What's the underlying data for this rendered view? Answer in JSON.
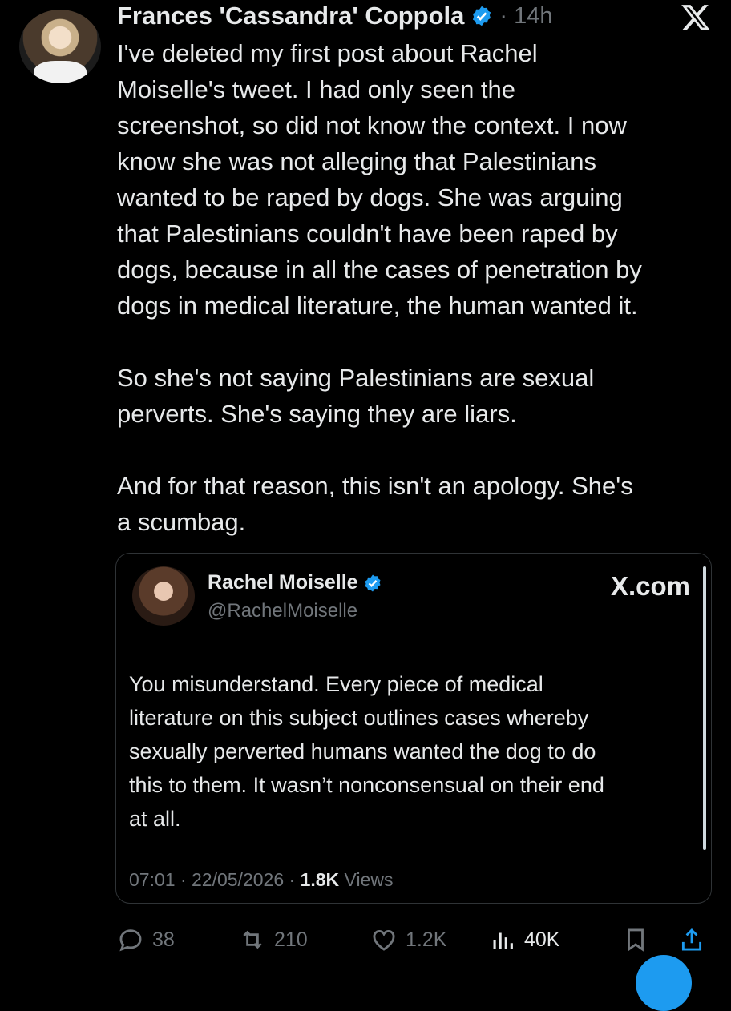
{
  "post": {
    "author": "Frances 'Cassandra' Coppola",
    "separator": "·",
    "time": "14h",
    "text": "I've deleted my first post about Rachel\nMoiselle's tweet. I had only seen the\nscreenshot, so did not know the context. I now\nknow she was not alleging that Palestinians\nwanted to be raped by dogs. She was arguing\nthat Palestinians couldn't have been raped by\ndogs, because in all the cases of penetration by\ndogs in medical literature, the human wanted it.\n\nSo she's not saying Palestinians are sexual\nperverts. She's saying they are liars.\n\nAnd for that reason, this isn't an apology. She's\na scumbag."
  },
  "quote": {
    "name": "Rachel Moiselle",
    "handle": "@RachelMoiselle",
    "site": "X.com",
    "text": "You misunderstand. Every piece of medical\nliterature on this subject outlines cases whereby\nsexually perverted humans wanted the dog to do\nthis to them. It wasn’t nonconsensual on their end\nat all.",
    "time": "07:01 · 22/05/2026 · ",
    "views_count": "1.8K",
    "views_label": " Views"
  },
  "actions": {
    "replies": "38",
    "reposts": "210",
    "likes": "1.2K",
    "views": "40K"
  },
  "icons": {
    "verified": "verified-badge-icon",
    "x_logo": "x-logo-icon",
    "reply": "reply-icon",
    "repost": "repost-icon",
    "like": "heart-icon",
    "views": "analytics-icon",
    "bookmark": "bookmark-icon",
    "share": "share-icon"
  },
  "colors": {
    "background": "#000000",
    "text": "#e7e9ea",
    "muted": "#71767b",
    "accent": "#1d9bf0"
  }
}
